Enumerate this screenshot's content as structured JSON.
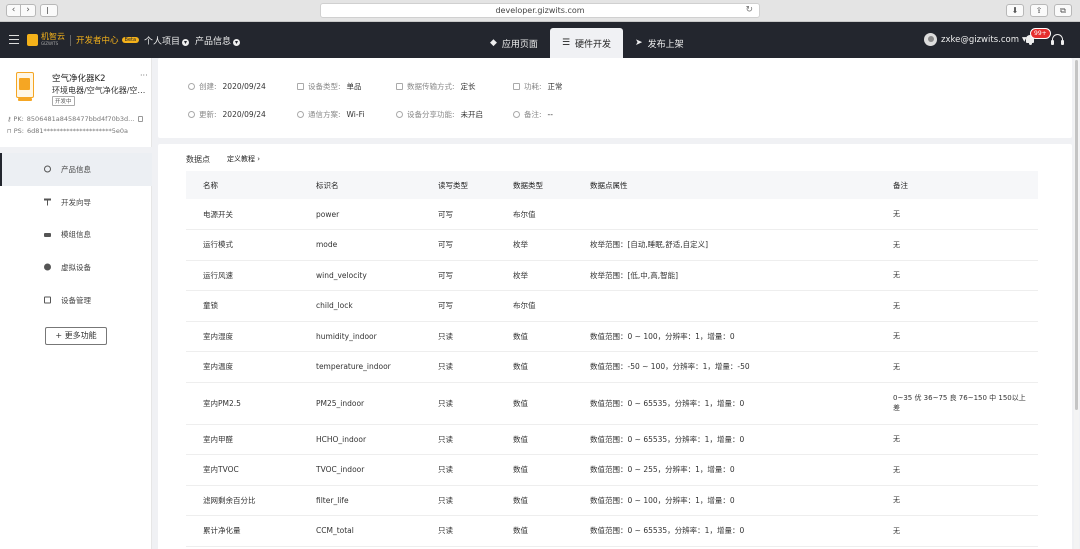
{
  "browser": {
    "url": "developer.gizwits.com"
  },
  "header": {
    "logo_text": "机智云",
    "logo_sub": "GIZWITS",
    "dev_center": "开发者中心",
    "beta": "Beta",
    "nav": [
      "个人项目",
      "产品信息"
    ],
    "tabs": [
      {
        "label": "应用页面",
        "icon": "diamond-icon"
      },
      {
        "label": "硬件开发",
        "icon": "sliders-icon"
      },
      {
        "label": "发布上架",
        "icon": "send-icon"
      }
    ],
    "active_tab": "硬件开发",
    "user_email": "zxke@gizwits.com",
    "notification_count": "99+"
  },
  "product": {
    "name": "空气净化器K2",
    "more": "···",
    "category": "环境电器/空气净化器/空气净化器",
    "status_tag": "开发中",
    "pk_label": "PK:",
    "pk_value": "8506481a8458477bbd4f70b3d...",
    "ps_label": "PS:",
    "ps_value": "6d81*********************5e0a"
  },
  "sidebar": {
    "items": [
      {
        "label": "产品信息",
        "icon": "info-circle-icon"
      },
      {
        "label": "开发向导",
        "icon": "hammer-icon"
      },
      {
        "label": "模组信息",
        "icon": "chip-icon"
      },
      {
        "label": "虚拟设备",
        "icon": "virtual-device-icon"
      },
      {
        "label": "设备管理",
        "icon": "device-manage-icon"
      }
    ],
    "more_button": "+ 更多功能"
  },
  "info": {
    "created_label": "创建:",
    "created_value": "2020/09/24",
    "updated_label": "更新:",
    "updated_value": "2020/09/24",
    "device_type_label": "设备类型:",
    "device_type_value": "单品",
    "comm_label": "通信方案:",
    "comm_value": "Wi-Fi",
    "transfer_label": "数据传输方式:",
    "transfer_value": "定长",
    "share_label": "设备分享功能:",
    "share_value": "未开启",
    "power_label": "功耗:",
    "power_value": "正常",
    "remark_label": "备注:",
    "remark_value": "--"
  },
  "datapoints": {
    "title": "数据点",
    "link": "定义教程 ›",
    "columns": [
      "名称",
      "标识名",
      "读写类型",
      "数据类型",
      "数据点属性",
      "备注"
    ],
    "rows": [
      [
        "电源开关",
        "power",
        "可写",
        "布尔值",
        "",
        "无"
      ],
      [
        "运行模式",
        "mode",
        "可写",
        "枚举",
        "枚举范围：[自动,睡眠,舒适,自定义]",
        "无"
      ],
      [
        "运行风速",
        "wind_velocity",
        "可写",
        "枚举",
        "枚举范围：[低,中,高,智能]",
        "无"
      ],
      [
        "童锁",
        "child_lock",
        "可写",
        "布尔值",
        "",
        "无"
      ],
      [
        "室内湿度",
        "humidity_indoor",
        "只读",
        "数值",
        "数值范围：0 ~ 100，分辨率：1，增量：0",
        "无"
      ],
      [
        "室内温度",
        "temperature_indoor",
        "只读",
        "数值",
        "数值范围：-50 ~ 100，分辨率：1，增量：-50",
        "无"
      ],
      [
        "室内PM2.5",
        "PM25_indoor",
        "只读",
        "数值",
        "数值范围：0 ~ 65535，分辨率：1，增量：0",
        "0~35 优 36~75 良 76~150 中 150以上 差"
      ],
      [
        "室内甲醛",
        "HCHO_indoor",
        "只读",
        "数值",
        "数值范围：0 ~ 65535，分辨率：1，增量：0",
        "无"
      ],
      [
        "室内TVOC",
        "TVOC_indoor",
        "只读",
        "数值",
        "数值范围：0 ~ 255，分辨率：1，增量：0",
        "无"
      ],
      [
        "滤网剩余百分比",
        "filter_life",
        "只读",
        "数值",
        "数值范围：0 ~ 100，分辨率：1，增量：0",
        "无"
      ],
      [
        "累计净化量",
        "CCM_total",
        "只读",
        "数值",
        "数值范围：0 ~ 65535，分辨率：1，增量：0",
        "无"
      ]
    ]
  }
}
